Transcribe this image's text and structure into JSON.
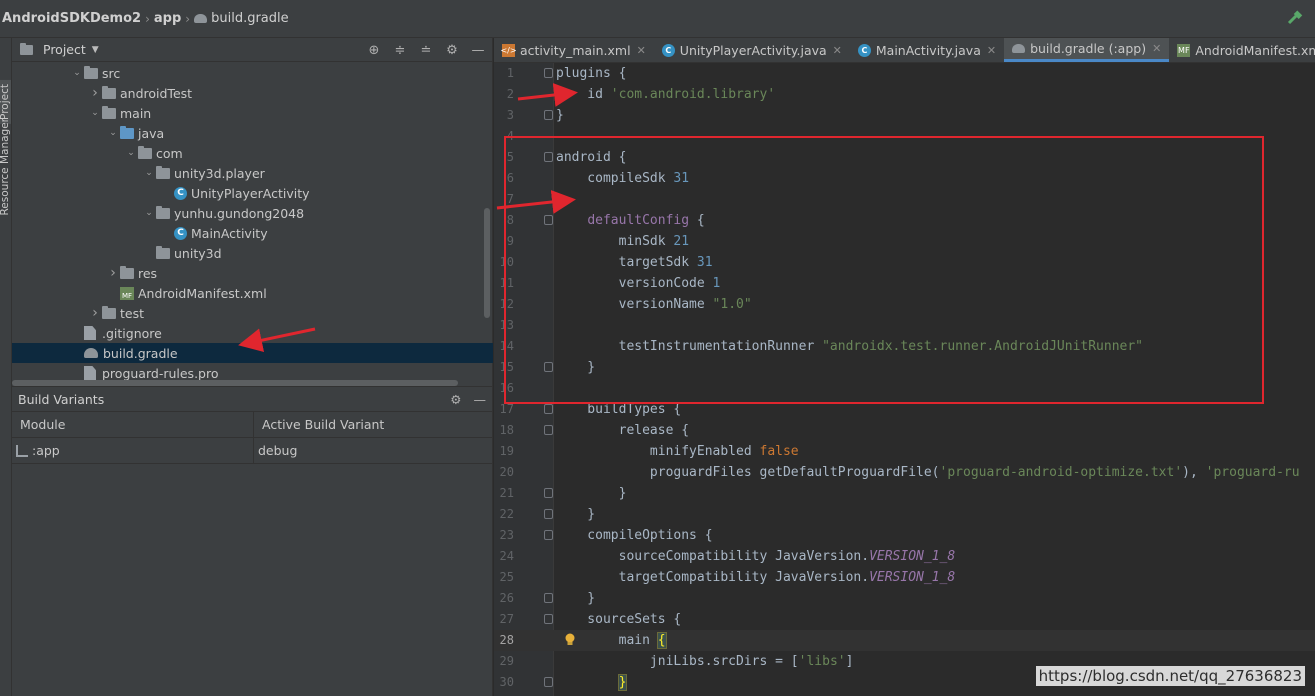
{
  "breadcrumb": {
    "project": "AndroidSDKDemo2",
    "module": "app",
    "file": "build.gradle"
  },
  "side_tabs": {
    "project": "Project",
    "resource_manager": "Resource Manager"
  },
  "project_panel": {
    "title": "Project",
    "tree": [
      {
        "label": "src",
        "depth": 1,
        "icon": "folder",
        "arrow": "down"
      },
      {
        "label": "androidTest",
        "depth": 2,
        "icon": "folder",
        "arrow": "right"
      },
      {
        "label": "main",
        "depth": 2,
        "icon": "folder",
        "arrow": "down"
      },
      {
        "label": "java",
        "depth": 3,
        "icon": "folder-blue",
        "arrow": "down"
      },
      {
        "label": "com",
        "depth": 4,
        "icon": "package",
        "arrow": "down"
      },
      {
        "label": "unity3d.player",
        "depth": 5,
        "icon": "package",
        "arrow": "down"
      },
      {
        "label": "UnityPlayerActivity",
        "depth": 6,
        "icon": "class",
        "arrow": ""
      },
      {
        "label": "yunhu.gundong2048",
        "depth": 5,
        "icon": "package",
        "arrow": "down"
      },
      {
        "label": "MainActivity",
        "depth": 6,
        "icon": "class",
        "arrow": ""
      },
      {
        "label": "unity3d",
        "depth": 5,
        "icon": "package",
        "arrow": ""
      },
      {
        "label": "res",
        "depth": 3,
        "icon": "folder-res",
        "arrow": "right"
      },
      {
        "label": "AndroidManifest.xml",
        "depth": 3,
        "icon": "manifest",
        "arrow": ""
      },
      {
        "label": "test",
        "depth": 2,
        "icon": "folder",
        "arrow": "right"
      },
      {
        "label": ".gitignore",
        "depth": 1,
        "icon": "file",
        "arrow": ""
      },
      {
        "label": "build.gradle",
        "depth": 1,
        "icon": "gradle",
        "arrow": "",
        "selected": true
      },
      {
        "label": "proguard-rules.pro",
        "depth": 1,
        "icon": "file",
        "arrow": ""
      }
    ]
  },
  "build_variants": {
    "title": "Build Variants",
    "col_module": "Module",
    "col_variant": "Active Build Variant",
    "rows": [
      {
        "module": ":app",
        "variant": "debug"
      }
    ]
  },
  "tabs": [
    {
      "label": "activity_main.xml",
      "icon": "xml",
      "active": false
    },
    {
      "label": "UnityPlayerActivity.java",
      "icon": "class",
      "active": false
    },
    {
      "label": "MainActivity.java",
      "icon": "class",
      "active": false
    },
    {
      "label": "build.gradle (:app)",
      "icon": "gradle",
      "active": true
    },
    {
      "label": "AndroidManifest.xml",
      "icon": "manifest",
      "active": false
    }
  ],
  "code_lines": [
    {
      "n": "1",
      "fold": true,
      "tokens": [
        [
          "p",
          "plugins {"
        ]
      ]
    },
    {
      "n": "2",
      "tokens": [
        [
          "p",
          "    id "
        ],
        [
          "str",
          "'com.android.library'"
        ]
      ]
    },
    {
      "n": "3",
      "fold": true,
      "tokens": [
        [
          "p",
          "}"
        ]
      ]
    },
    {
      "n": "4",
      "tokens": []
    },
    {
      "n": "5",
      "fold": true,
      "tokens": [
        [
          "p",
          "android {"
        ]
      ]
    },
    {
      "n": "6",
      "tokens": [
        [
          "p",
          "    compileSdk "
        ],
        [
          "num",
          "31"
        ]
      ]
    },
    {
      "n": "7",
      "tokens": []
    },
    {
      "n": "8",
      "fold": true,
      "tokens": [
        [
          "p",
          "    "
        ],
        [
          "gid",
          "defaultConfig"
        ],
        [
          "p",
          " {"
        ]
      ]
    },
    {
      "n": "9",
      "tokens": [
        [
          "p",
          "        minSdk "
        ],
        [
          "num",
          "21"
        ]
      ]
    },
    {
      "n": "10",
      "tokens": [
        [
          "p",
          "        targetSdk "
        ],
        [
          "num",
          "31"
        ]
      ]
    },
    {
      "n": "11",
      "tokens": [
        [
          "p",
          "        versionCode "
        ],
        [
          "num",
          "1"
        ]
      ]
    },
    {
      "n": "12",
      "tokens": [
        [
          "p",
          "        versionName "
        ],
        [
          "str",
          "\"1.0\""
        ]
      ]
    },
    {
      "n": "13",
      "tokens": []
    },
    {
      "n": "14",
      "tokens": [
        [
          "p",
          "        testInstrumentationRunner "
        ],
        [
          "str",
          "\"androidx.test.runner.AndroidJUnitRunner\""
        ]
      ]
    },
    {
      "n": "15",
      "fold": true,
      "tokens": [
        [
          "p",
          "    }"
        ]
      ]
    },
    {
      "n": "16",
      "tokens": []
    },
    {
      "n": "17",
      "fold": true,
      "tokens": [
        [
          "p",
          "    buildTypes {"
        ]
      ]
    },
    {
      "n": "18",
      "fold": true,
      "tokens": [
        [
          "p",
          "        release {"
        ]
      ]
    },
    {
      "n": "19",
      "tokens": [
        [
          "p",
          "            minifyEnabled "
        ],
        [
          "kw",
          "false"
        ]
      ]
    },
    {
      "n": "20",
      "tokens": [
        [
          "p",
          "            proguardFiles getDefaultProguardFile("
        ],
        [
          "str",
          "'proguard-android-optimize.txt'"
        ],
        [
          "p",
          "), "
        ],
        [
          "str",
          "'proguard-ru"
        ]
      ]
    },
    {
      "n": "21",
      "fold": true,
      "tokens": [
        [
          "p",
          "        }"
        ]
      ]
    },
    {
      "n": "22",
      "fold": true,
      "tokens": [
        [
          "p",
          "    }"
        ]
      ]
    },
    {
      "n": "23",
      "fold": true,
      "tokens": [
        [
          "p",
          "    compileOptions {"
        ]
      ]
    },
    {
      "n": "24",
      "tokens": [
        [
          "p",
          "        sourceCompatibility JavaVersion."
        ],
        [
          "it",
          "VERSION_1_8"
        ]
      ]
    },
    {
      "n": "25",
      "tokens": [
        [
          "p",
          "        targetCompatibility JavaVersion."
        ],
        [
          "it",
          "VERSION_1_8"
        ]
      ]
    },
    {
      "n": "26",
      "fold": true,
      "tokens": [
        [
          "p",
          "    }"
        ]
      ]
    },
    {
      "n": "27",
      "fold": true,
      "tokens": [
        [
          "p",
          "    sourceSets {"
        ]
      ]
    },
    {
      "n": "28",
      "current": true,
      "bulb": true,
      "tokens": [
        [
          "p",
          "        main "
        ],
        [
          "hl",
          "{"
        ]
      ]
    },
    {
      "n": "29",
      "tokens": [
        [
          "p",
          "            jniLibs.srcDirs = ["
        ],
        [
          "str",
          "'libs'"
        ],
        [
          "p",
          "]"
        ]
      ]
    },
    {
      "n": "30",
      "fold": true,
      "tokens": [
        [
          "p",
          "        "
        ],
        [
          "hl",
          "}"
        ]
      ]
    }
  ],
  "watermark": "https://blog.csdn.net/qq_27636823",
  "colors": {
    "annotation_red": "#e0262e",
    "tab_accent": "#4a88c7",
    "selection": "#0d293e"
  }
}
